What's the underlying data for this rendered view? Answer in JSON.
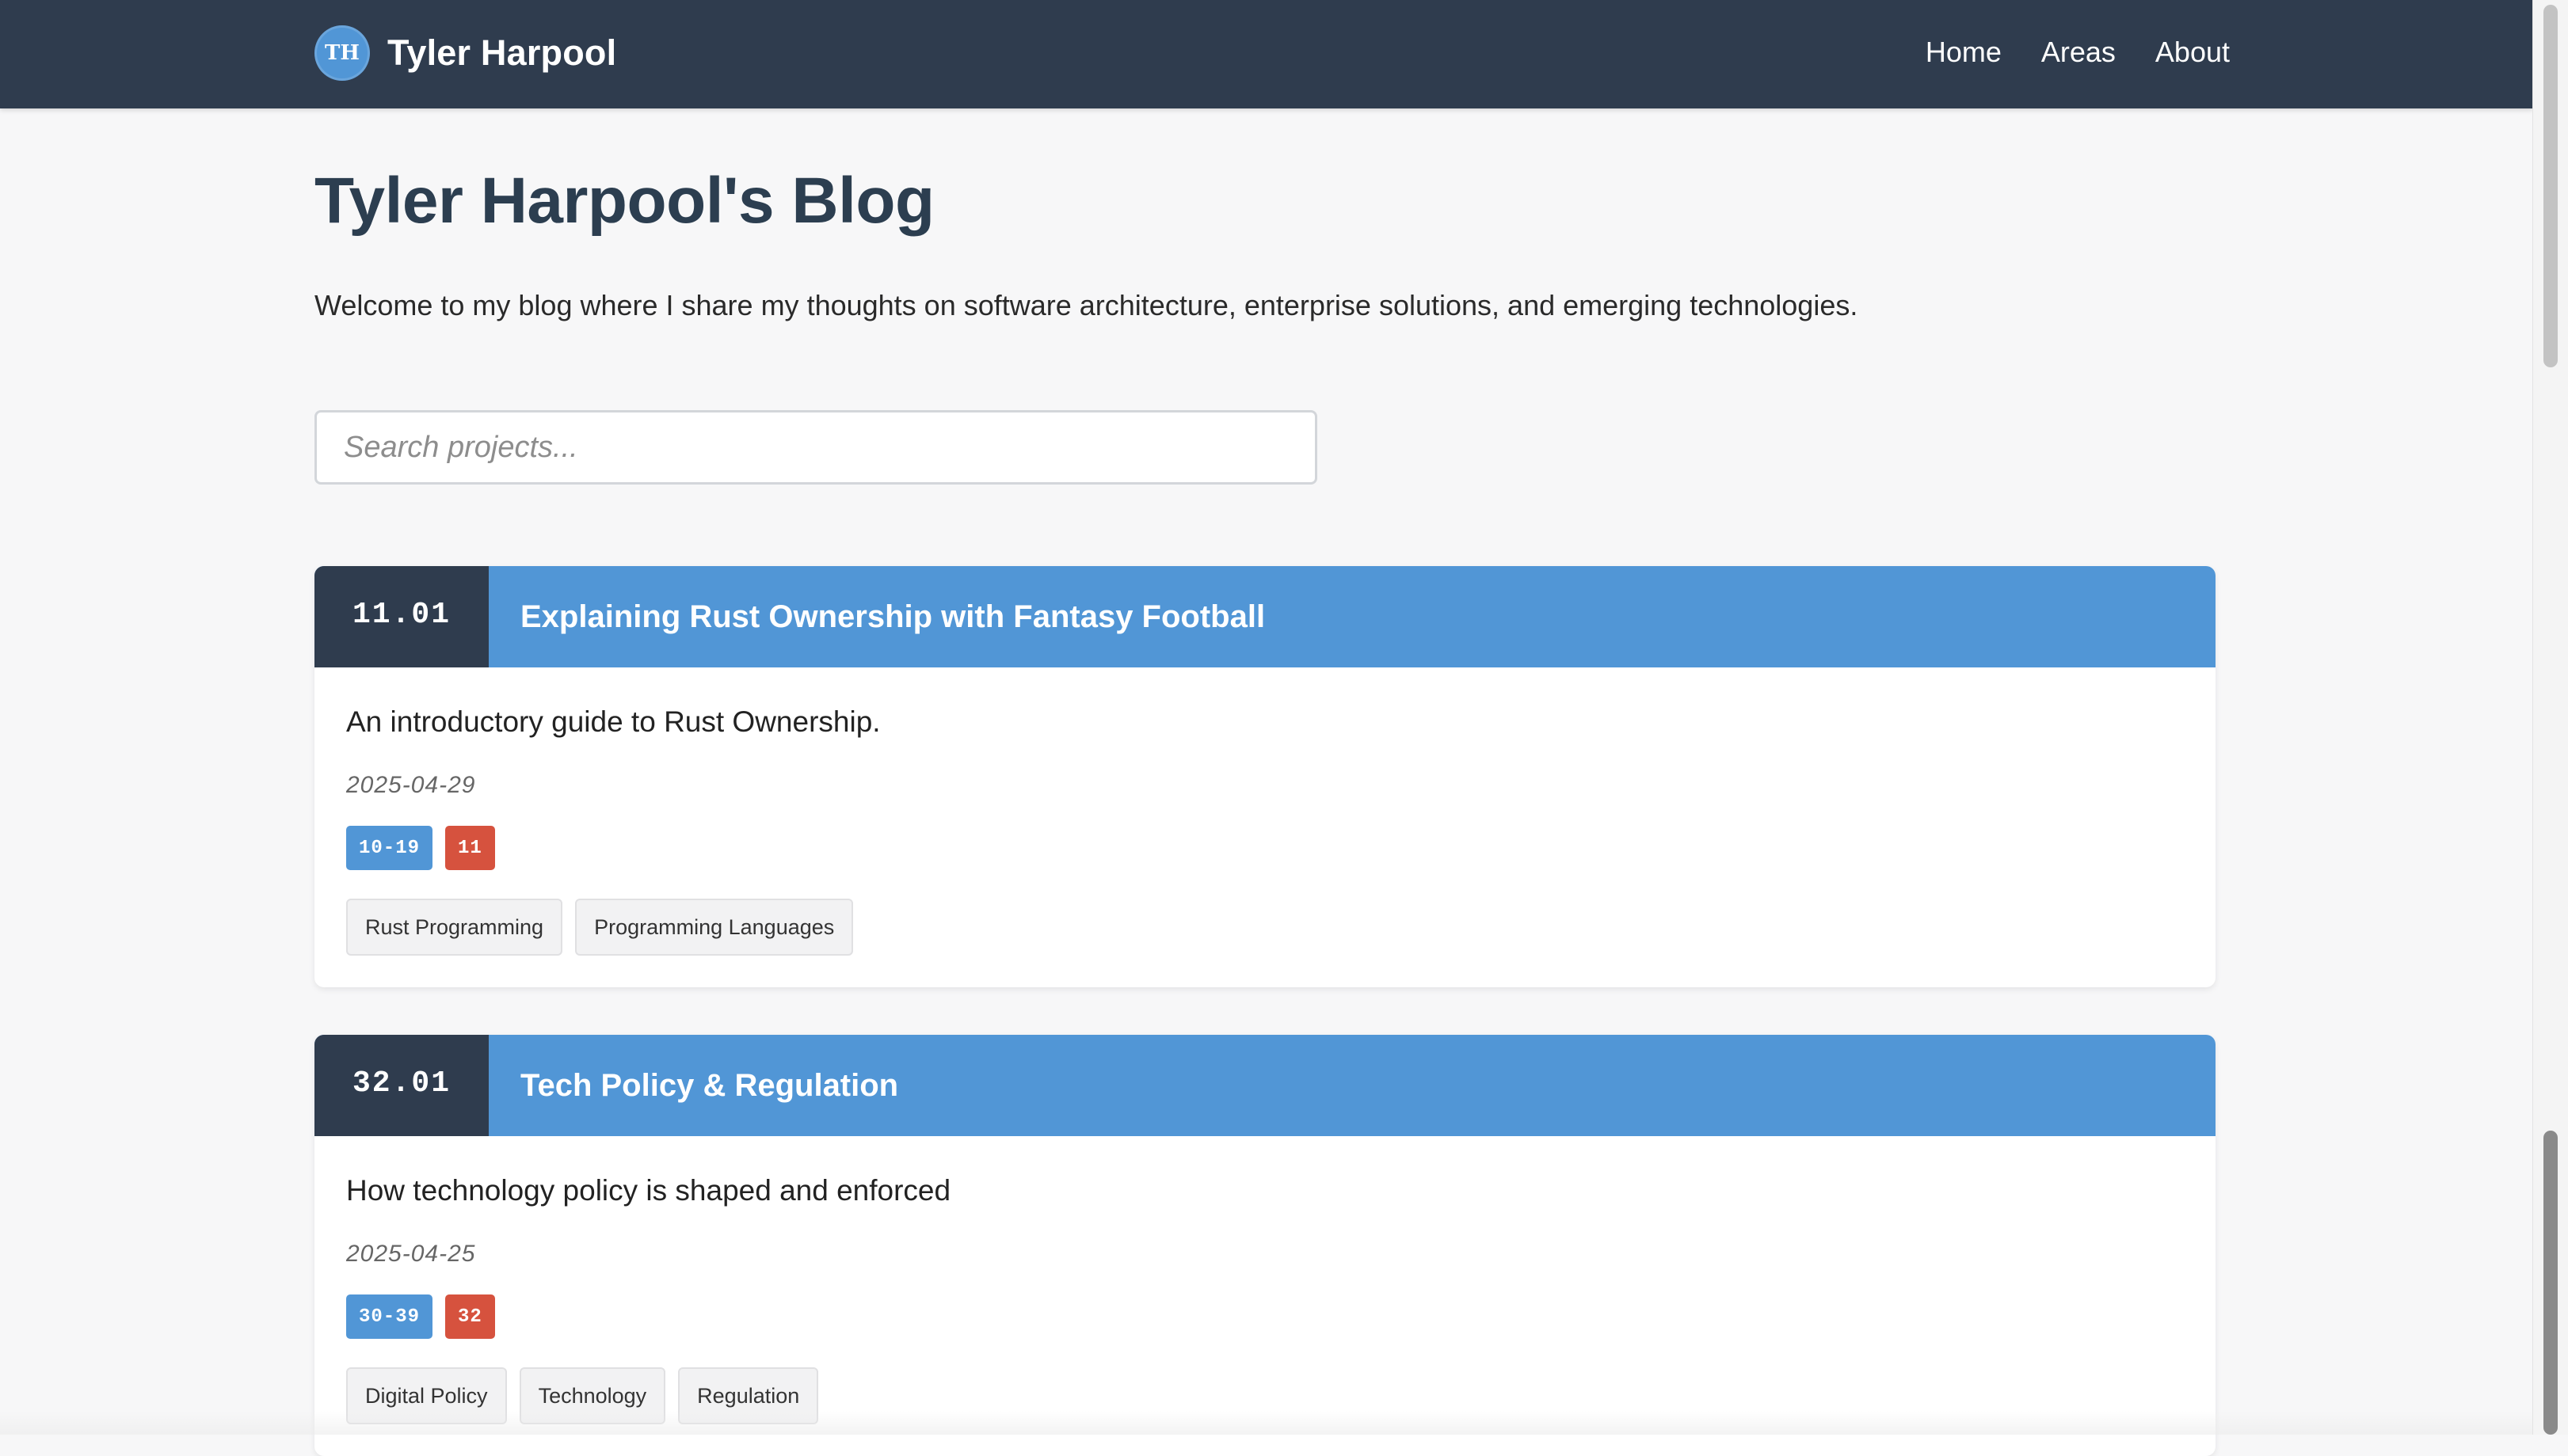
{
  "header": {
    "logo_initials": "TH",
    "brand_name": "Tyler Harpool",
    "nav": [
      {
        "label": "Home"
      },
      {
        "label": "Areas"
      },
      {
        "label": "About"
      }
    ]
  },
  "main": {
    "title": "Tyler Harpool's Blog",
    "intro": "Welcome to my blog where I share my thoughts on software architecture, enterprise solutions, and emerging technologies.",
    "search": {
      "placeholder": "Search projects...",
      "value": ""
    },
    "projects": [
      {
        "id": "11.01",
        "title": "Explaining Rust Ownership with Fantasy Football",
        "description": "An introductory guide to Rust Ownership.",
        "date": "2025-04-29",
        "area_range": "10-19",
        "category": "11",
        "tags": [
          "Rust Programming",
          "Programming Languages"
        ]
      },
      {
        "id": "32.01",
        "title": "Tech Policy & Regulation",
        "description": "How technology policy is shaped and enforced",
        "date": "2025-04-25",
        "area_range": "30-39",
        "category": "32",
        "tags": [
          "Digital Policy",
          "Technology",
          "Regulation"
        ]
      }
    ]
  },
  "colors": {
    "navbar": "#2f3c4e",
    "accent_blue": "#5196d6",
    "accent_red": "#d6523e",
    "background": "#f7f7f8"
  }
}
